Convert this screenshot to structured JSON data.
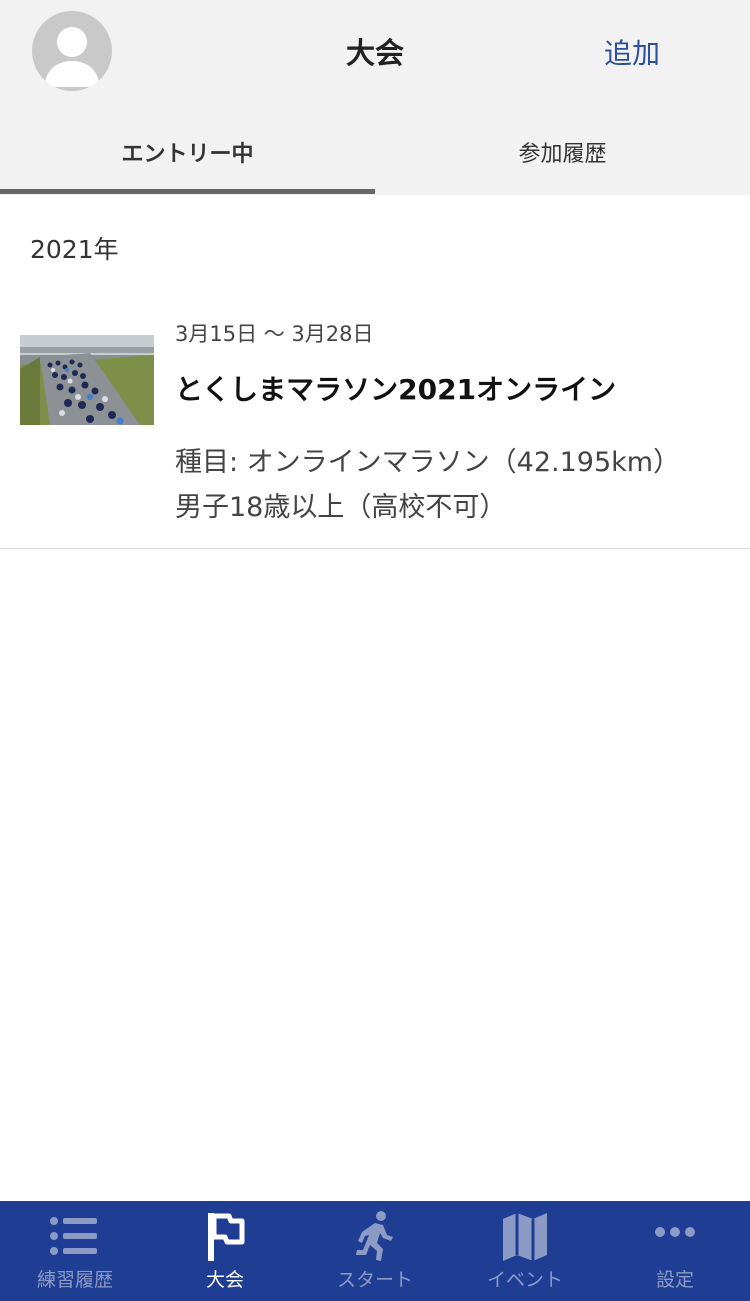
{
  "header": {
    "title": "大会",
    "add_label": "追加"
  },
  "tabs": [
    {
      "label": "エントリー中",
      "active": true
    },
    {
      "label": "参加履歴",
      "active": false
    }
  ],
  "list": {
    "year_heading": "2021年",
    "items": [
      {
        "dates": "3月15日 〜 3月28日",
        "name": "とくしまマラソン2021オンライン",
        "event_line": "種目: オンラインマラソン（42.195km）",
        "category_line": "男子18歳以上（高校不可）"
      }
    ]
  },
  "tabbar": {
    "items": [
      {
        "label": "練習履歴",
        "icon": "list-icon",
        "active": false
      },
      {
        "label": "大会",
        "icon": "flag-icon",
        "active": true
      },
      {
        "label": "スタート",
        "icon": "runner-icon",
        "active": false
      },
      {
        "label": "イベント",
        "icon": "map-icon",
        "active": false
      },
      {
        "label": "設定",
        "icon": "more-icon",
        "active": false
      }
    ],
    "background": "#1f3d93",
    "active_color": "#ffffff",
    "inactive_color": "#8c9ac6"
  },
  "colors": {
    "link": "#2d4f9e",
    "header_bg": "#f2f2f2"
  }
}
